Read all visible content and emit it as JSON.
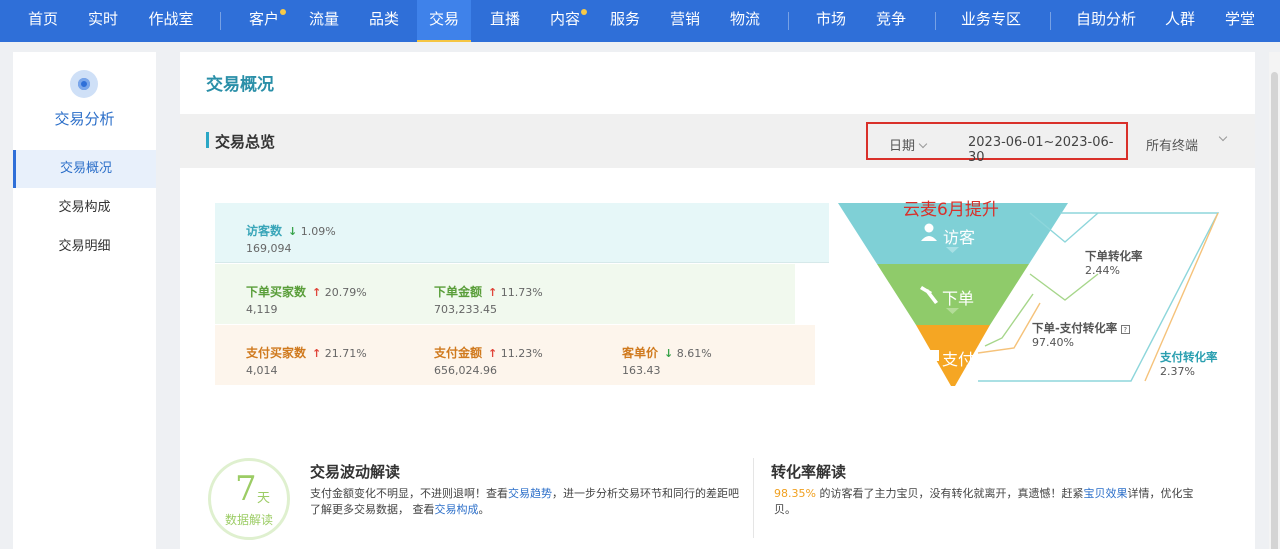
{
  "nav": {
    "items": [
      {
        "label": "首页"
      },
      {
        "label": "实时"
      },
      {
        "label": "作战室"
      },
      {
        "label": "客户",
        "dot": true
      },
      {
        "label": "流量"
      },
      {
        "label": "品类"
      },
      {
        "label": "交易",
        "active": true
      },
      {
        "label": "直播"
      },
      {
        "label": "内容",
        "dot": true
      },
      {
        "label": "服务"
      },
      {
        "label": "营销"
      },
      {
        "label": "物流"
      },
      {
        "label": "市场"
      },
      {
        "label": "竞争"
      },
      {
        "label": "业务专区"
      },
      {
        "label": "自助分析"
      },
      {
        "label": "人群"
      },
      {
        "label": "学堂"
      }
    ]
  },
  "sidebar": {
    "title": "交易分析",
    "items": [
      {
        "label": "交易概况",
        "active": true
      },
      {
        "label": "交易构成"
      },
      {
        "label": "交易明细"
      }
    ]
  },
  "page": {
    "title": "交易概况",
    "section_title": "交易总览",
    "date_label": "日期",
    "date_range": "2023-06-01~2023-06-30",
    "terminal": "所有终端"
  },
  "metrics": {
    "visitors": {
      "label": "访客数",
      "direction": "down",
      "change": "1.09%",
      "value": "169,094"
    },
    "order_buyers": {
      "label": "下单买家数",
      "direction": "up",
      "change": "20.79%",
      "value": "4,119"
    },
    "order_amount": {
      "label": "下单金额",
      "direction": "up",
      "change": "11.73%",
      "value": "703,233.45"
    },
    "pay_buyers": {
      "label": "支付买家数",
      "direction": "up",
      "change": "21.71%",
      "value": "4,014"
    },
    "pay_amount": {
      "label": "支付金额",
      "direction": "up",
      "change": "11.23%",
      "value": "656,024.96"
    },
    "unit_price": {
      "label": "客单价",
      "direction": "down",
      "change": "8.61%",
      "value": "163.43"
    }
  },
  "arrows": {
    "up": "↑",
    "down": "↓"
  },
  "funnel": {
    "annotation": "云麦6月提升",
    "stages": [
      "访客",
      "下单",
      "支付"
    ],
    "conversions": {
      "visit_to_order": {
        "label": "下单转化率",
        "value": "2.44%"
      },
      "order_to_pay": {
        "label": "下单-支付转化率",
        "value": "97.40%"
      },
      "visit_to_pay": {
        "label": "支付转化率",
        "value": "2.37%"
      }
    },
    "colors": {
      "visit": "#7fd0d6",
      "order": "#8fcb6a",
      "pay": "#f5a623"
    }
  },
  "badge": {
    "number": "7",
    "unit": "天",
    "text": "数据解读"
  },
  "insights": {
    "wave": {
      "title": "交易波动解读",
      "p1": "支付金额变化不明显，不进则退啊！查看",
      "link1": "交易趋势",
      "p2": "，进一步分析交易环节和同行的差距吧",
      "p3": "了解更多交易数据，  查看",
      "link2": "交易构成",
      "p4": "。"
    },
    "conversion": {
      "title": "转化率解读",
      "pct": "98.35%",
      "p1": " 的访客看了主力宝贝，没有转化就离开，真遗憾！赶紧",
      "link": "宝贝效果",
      "p2": "详情，优化宝",
      "p3": "贝。"
    }
  }
}
